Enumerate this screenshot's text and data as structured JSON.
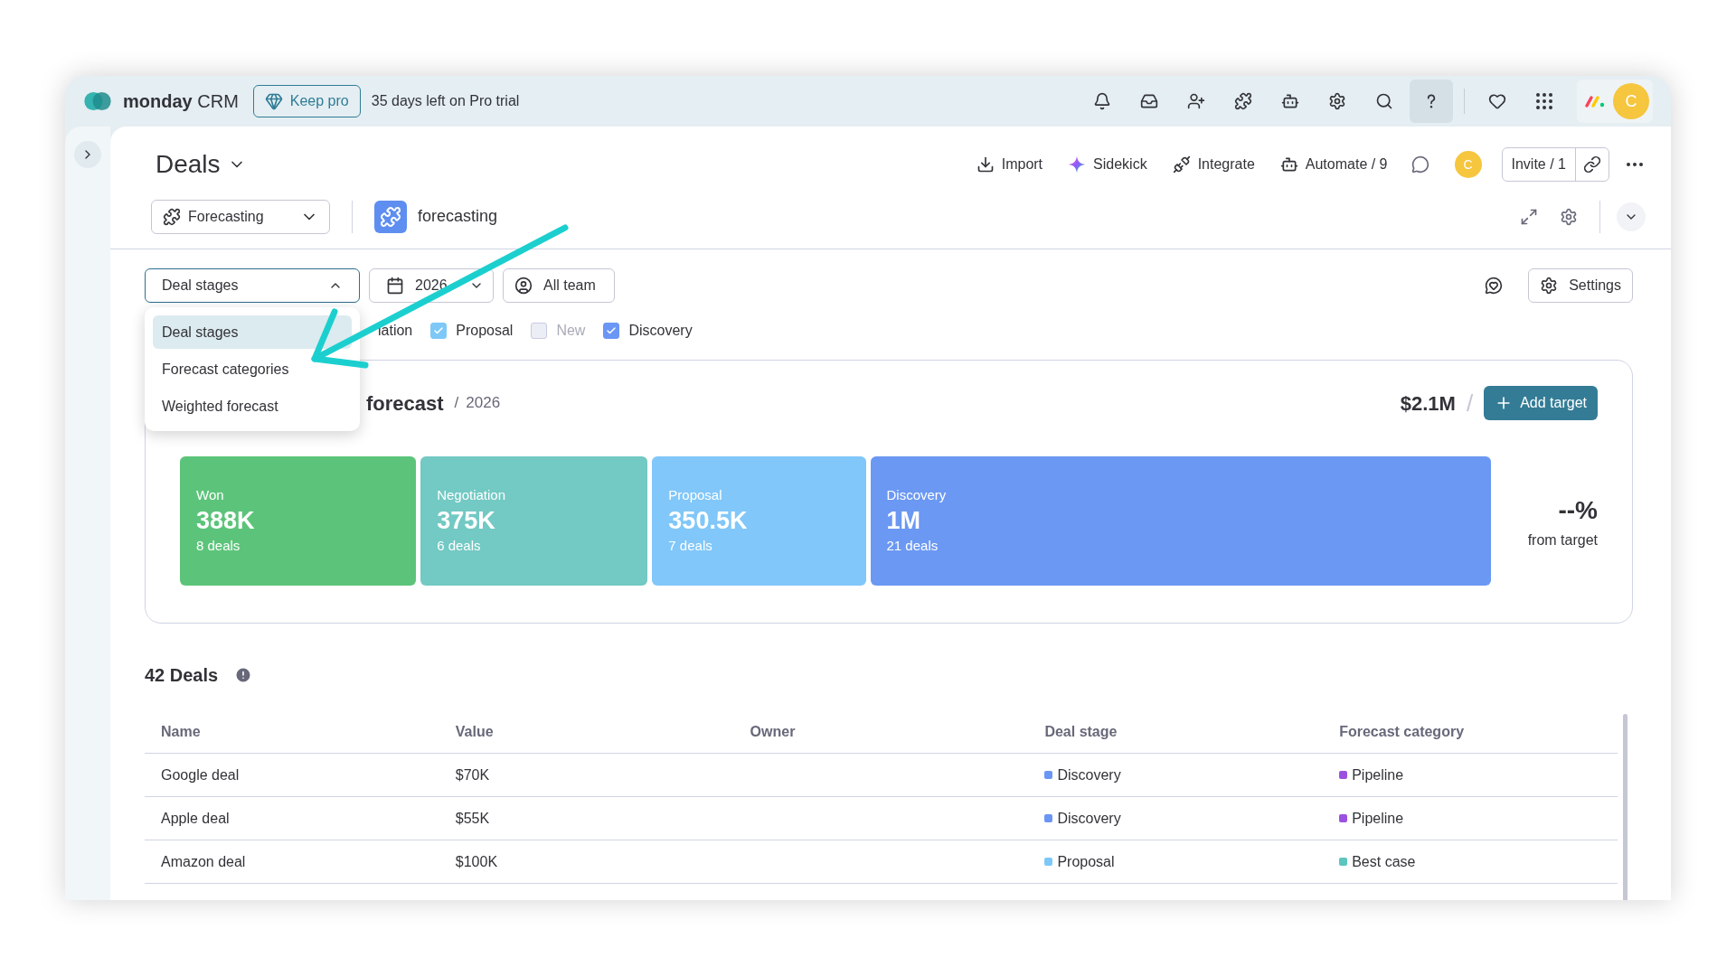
{
  "topbar": {
    "brand": "monday",
    "brand_suffix": "CRM",
    "keep_pro": "Keep pro",
    "trial": "35 days left on Pro trial",
    "avatar": "C"
  },
  "header": {
    "title": "Deals",
    "actions": [
      {
        "kind": "import",
        "label": "Import"
      },
      {
        "kind": "sidekick",
        "label": "Sidekick"
      },
      {
        "kind": "integrate",
        "label": "Integrate"
      },
      {
        "kind": "automate",
        "label": "Automate / 9"
      }
    ],
    "avatar": "C",
    "invite": "Invite / 1"
  },
  "view": {
    "tab": "Forecasting",
    "name": "forecasting"
  },
  "filters": {
    "mode": "Deal stages",
    "year": "2026",
    "team": "All team",
    "settings": "Settings",
    "menu_open": true
  },
  "menu": [
    {
      "label": "Deal stages",
      "selected": true
    },
    {
      "label": "Forecast categories",
      "selected": false
    },
    {
      "label": "Weighted forecast",
      "selected": false
    }
  ],
  "stage_filter_fragment": "iation",
  "stage_filters": [
    {
      "label": "Proposal",
      "checked": true,
      "color": "#7ec8f8"
    },
    {
      "label": "New",
      "checked": false,
      "color": "#c8cbe0"
    },
    {
      "label": "Discovery",
      "checked": true,
      "color": "#6b96f5"
    }
  ],
  "forecast": {
    "title": "forecast",
    "year_separator": "/",
    "year": "2026",
    "total": "$2.1M",
    "total_separator": "/",
    "add_target": "Add target",
    "percent": "--%",
    "percent_label": "from target",
    "stages": [
      {
        "name": "Won",
        "amount": "388K",
        "deals": "8 deals",
        "color": "#5cc47a"
      },
      {
        "name": "Negotiation",
        "amount": "375K",
        "deals": "6 deals",
        "color": "#73c9c3"
      },
      {
        "name": "Proposal",
        "amount": "350.5K",
        "deals": "7 deals",
        "color": "#81c7f9"
      },
      {
        "name": "Discovery",
        "amount": "1M",
        "deals": "21 deals",
        "color": "#6b98f3"
      }
    ]
  },
  "deals": {
    "title": "42 Deals",
    "columns": [
      "Name",
      "Value",
      "Owner",
      "Deal stage",
      "Forecast category"
    ],
    "rows": [
      {
        "name": "Google deal",
        "value": "$70K",
        "stage": {
          "label": "Discovery",
          "color": "#6b96f5"
        },
        "category": {
          "label": "Pipeline",
          "color": "#9b51e0"
        }
      },
      {
        "name": "Apple deal",
        "value": "$55K",
        "stage": {
          "label": "Discovery",
          "color": "#6b96f5"
        },
        "category": {
          "label": "Pipeline",
          "color": "#9b51e0"
        }
      },
      {
        "name": "Amazon deal",
        "value": "$100K",
        "stage": {
          "label": "Proposal",
          "color": "#7ec8f8"
        },
        "category": {
          "label": "Best case",
          "color": "#5dc5bd"
        }
      }
    ]
  }
}
